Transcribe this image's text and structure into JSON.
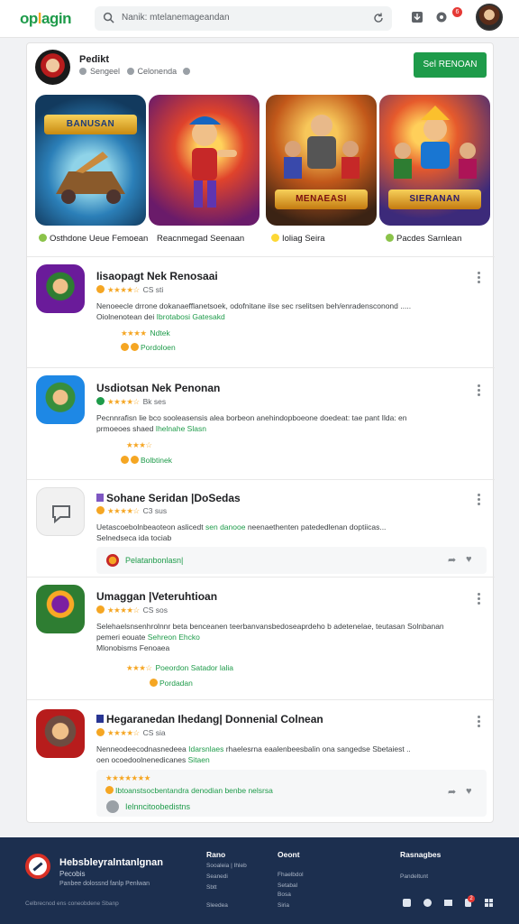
{
  "header": {
    "logo_part1": "op",
    "logo_part2": "l",
    "logo_part3": "agin",
    "search_placeholder": "Nanik: mtelanemageandan",
    "notification_count": "6"
  },
  "developer": {
    "name": "Pedikt",
    "meta_left": "Sengeel",
    "meta_right": "Celonenda",
    "follow_label": "Sel RENOAN"
  },
  "featured": [
    {
      "banner": "BANUSAN",
      "label": "Osthdone Ueue Femoean"
    },
    {
      "banner": "",
      "label": "Reacnmegad Seenaan"
    },
    {
      "banner": "MENAEASI",
      "label": "Ioliag Seira"
    },
    {
      "banner": "SIERANAN",
      "label": "Pacdes Sarnlean"
    }
  ],
  "apps": [
    {
      "title": "Iisaopagt Nek Renosaai",
      "rating": "★★★★☆",
      "rating_text": "CS sti",
      "desc_a": "Nenoeecle drrone dokanaefflanetsoek, odofnitane ilse sec rselitsen beh/enradensconond .....",
      "desc_b": "Oiolnenotean dei",
      "desc_link": "Ibrotabosi Gatesakd",
      "row1_stars": "★★★★",
      "row1_text": "Ndtek",
      "row2_text": "Pordoloen"
    },
    {
      "title": "Usdiotsan Nek Penonan",
      "rating": "★★★★☆",
      "rating_text": "Bk ses",
      "desc_a": "Pecnnrafisn lie bco sooleasensis alea borbeon anehindopboeone doedeat: tae pant Ilda: en",
      "desc_b": "prmoeoes shaed",
      "desc_link": "Ihelnahe Slasn",
      "row1_stars": "★★★☆",
      "row2_text": "Bolbtinek"
    },
    {
      "title": "Sohane Seridan |DoSedas",
      "rating": "★★★★☆",
      "rating_text": "C3 sus",
      "desc_a": "Uetascoebolnbeaoteon aslicedt",
      "desc_link_a": "sen danooe",
      "desc_a2": "neenaethenten patededlenan doptiicas...",
      "desc_b": "Selnedseca ida tociab",
      "sub": "Pelatanbonlasn|"
    },
    {
      "title": "Umaggan |Veteruhtioan",
      "rating": "★★★★☆",
      "rating_text": "CS sos",
      "desc_a": "Selehaelsnsenhrolnnr beta benceanen teerbanvansbedoseaprdeho b adetenelae, teutasan Solnbanan",
      "desc_b": "pemeri eouate",
      "desc_link": "Sehreon Ehcko",
      "desc_c": "Mlonobisms Fenoaea",
      "row1_stars": "★★★☆",
      "row1_text": "Poeordon Satador lalia",
      "row2_text": "Pordadan"
    },
    {
      "title": "Hegaranedan Ihedang| Donnenial Colnean",
      "rating": "★★★★☆",
      "rating_text": "CS sia",
      "desc_a": "Nenneodeecodnasnedeea",
      "desc_link_a": "Idarsnlaes",
      "desc_a2": "rhaelesrna eaalenbeesbalin ona sangedse Sbetaiest ..",
      "desc_b": "oen ocoedoolnenedicanes",
      "desc_link": "Sitaen",
      "row1_stars": "★★★★★★★",
      "row1_text": "Ibtoanstsocbentandra denodian benbe nelsrsa",
      "sub": "Ielnncitoobedistns"
    }
  ],
  "footer": {
    "brand": "Hebsbleyralntanlgnan",
    "sub": "Pecobis",
    "tag": "Panbee dolossnd fanlp Penlwan",
    "copy": "Celbrecnod ens coneobdene Sbanp",
    "col1_head": "Rano",
    "col1_links": [
      "Sooaleia | Ihleb",
      "Seanedi",
      "Sbtt",
      "Sleedea"
    ],
    "col2_head": "Oeont",
    "col2_links": [
      "Fhaelbdol",
      "Setabal",
      "Bosa",
      "Siria"
    ],
    "col3_head": "Rasnagbes",
    "col3_links": [
      "Pandeltunt"
    ],
    "social_badge": "2"
  },
  "colors": {
    "accent": "#1e9b4a",
    "star": "#f5a623",
    "footer": "#1c2f4f",
    "badge": "#e53935"
  },
  "icons": [
    "search-icon",
    "refresh-icon",
    "download-icon",
    "settings-icon",
    "more-vert-icon",
    "share-icon",
    "heart-icon"
  ]
}
